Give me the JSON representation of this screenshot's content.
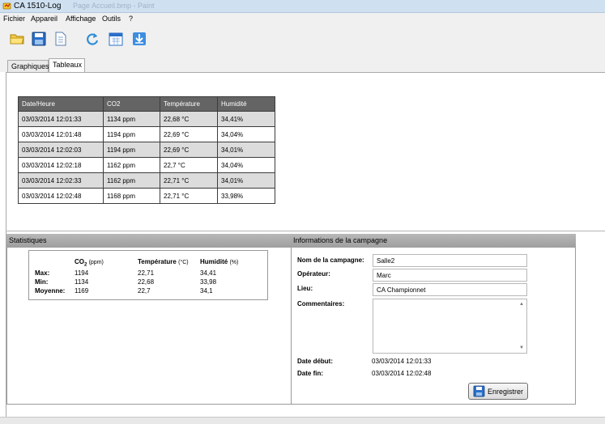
{
  "window": {
    "title": "CA 1510-Log",
    "faded_title": "Page Accueil.bmp - Paint"
  },
  "menu": [
    "Fichier",
    "Appareil",
    "Affichage",
    "Outils",
    "?"
  ],
  "toolbar": [
    "open-folder-icon",
    "save-disk-icon",
    "document-icon",
    "refresh-icon",
    "calendar-icon",
    "download-icon"
  ],
  "tabs": [
    {
      "label": "Graphiques",
      "active": false
    },
    {
      "label": "Tableaux",
      "active": true
    }
  ],
  "data_table": {
    "headers": [
      "Date/Heure",
      "CO2",
      "Température",
      "Humidité"
    ],
    "rows": [
      [
        "03/03/2014 12:01:33",
        "1134 ppm",
        "22,68 °C",
        "34,41%"
      ],
      [
        "03/03/2014 12:01:48",
        "1194 ppm",
        "22,69 °C",
        "34,04%"
      ],
      [
        "03/03/2014 12:02:03",
        "1194 ppm",
        "22,69 °C",
        "34,01%"
      ],
      [
        "03/03/2014 12:02:18",
        "1162 ppm",
        "22,7 °C",
        "34,04%"
      ],
      [
        "03/03/2014 12:02:33",
        "1162 ppm",
        "22,71 °C",
        "34,01%"
      ],
      [
        "03/03/2014 12:02:48",
        "1168 ppm",
        "22,71 °C",
        "33,98%"
      ]
    ]
  },
  "stats": {
    "title": "Statistiques",
    "head": {
      "co2": "CO",
      "co2_sub": "2",
      "co2_unit": "(ppm)",
      "temp": "Température",
      "temp_unit": "(°C)",
      "hum": "Humidité",
      "hum_unit": "(%)"
    },
    "labels": {
      "max": "Max:",
      "min": "Min:",
      "avg": "Moyenne:"
    },
    "max": {
      "co2": "1194",
      "temp": "22,71",
      "hum": "34,41"
    },
    "min": {
      "co2": "1134",
      "temp": "22,68",
      "hum": "33,98"
    },
    "avg": {
      "co2": "1169",
      "temp": "22,7",
      "hum": "34,1"
    }
  },
  "campaign": {
    "title": "Informations de la campagne",
    "name_label": "Nom de la campagne:",
    "name_value": "Salle2",
    "operator_label": "Opérateur:",
    "operator_value": "Marc",
    "place_label": "Lieu:",
    "place_value": "CA Championnet",
    "comments_label": "Commentaires:",
    "comments_value": "",
    "start_label": "Date début:",
    "start_value": "03/03/2014 12:01:33",
    "end_label": "Date fin:",
    "end_value": "03/03/2014 12:02:48",
    "save_label": "Enregistrer"
  },
  "colors": {
    "grid_header": "#646464",
    "grid_row_alt": "#dcdcdc",
    "section_header": "#a8a8a8"
  }
}
